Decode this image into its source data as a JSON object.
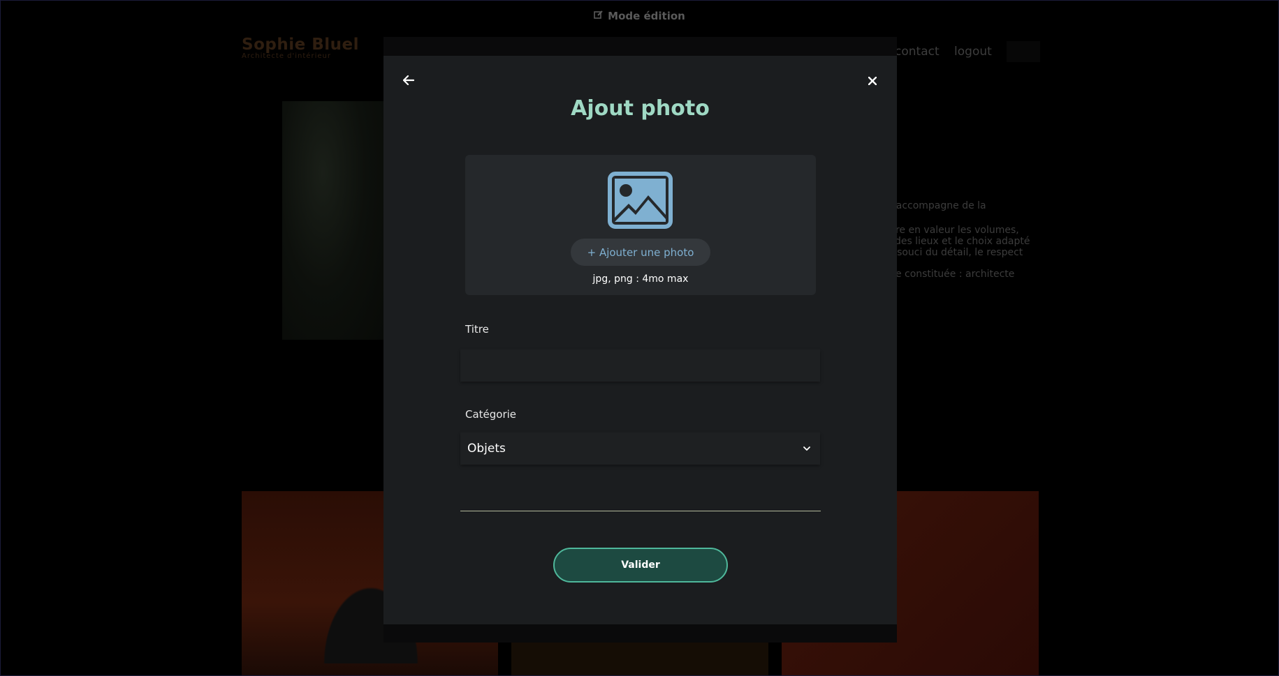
{
  "background": {
    "edit_mode_label": "Mode édition",
    "logo": {
      "name": "Sophie Bluel",
      "subtitle": "Architecte d'intérieur"
    },
    "nav": {
      "contact": "contact",
      "logout": "logout"
    },
    "intro_lines": [
      "s accompagne de la",
      "ttre en valeur les volumes,",
      "t des lieux et le choix adapté",
      "e souci du détail, le respect",
      "tre constituée : architecte"
    ]
  },
  "modal": {
    "title": "Ajout photo",
    "back_icon": "arrow-left-icon",
    "close_icon": "close-icon",
    "upload": {
      "icon": "image-icon",
      "button_label": "+ Ajouter une photo",
      "hint": "jpg, png : 4mo max"
    },
    "fields": {
      "title_label": "Titre",
      "title_value": "",
      "category_label": "Catégorie",
      "category_value": "Objets"
    },
    "submit_label": "Valider"
  },
  "colors": {
    "accent": "#9fd9c4",
    "upload_icon": "#7fb0d1",
    "submit_bg": "#1d4a41",
    "submit_border": "#4fb89b"
  }
}
